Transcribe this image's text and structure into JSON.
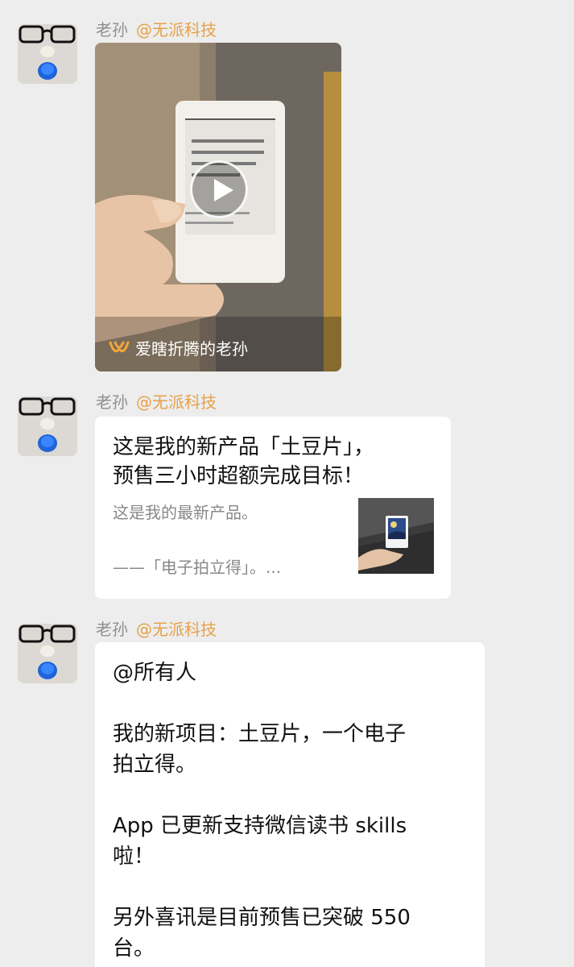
{
  "messages": [
    {
      "sender": "老孙",
      "group_tag": "@无派科技",
      "type": "video",
      "video": {
        "caption": "爱瞎折腾的老孙",
        "caption_icon": "wechat-channels-icon"
      }
    },
    {
      "sender": "老孙",
      "group_tag": "@无派科技",
      "type": "link-card",
      "card": {
        "title_line1": "这是我的新产品「土豆片」，",
        "title_line2": "预售三小时超额完成目标！",
        "desc_line1": "这是我的最新产品。",
        "desc_line2": "——「电子拍立得」。..."
      }
    },
    {
      "sender": "老孙",
      "group_tag": "@无派科技",
      "type": "text",
      "text_lines": [
        "@所有人",
        "",
        "我的新项目：土豆片，一个电子",
        "拍立得。",
        "",
        "App 已更新支持微信读书 skills",
        "啦！",
        "",
        "另外喜讯是目前预售已突破 550",
        "台。"
      ]
    }
  ],
  "colors": {
    "background": "#ededed",
    "bubble": "#ffffff",
    "sender_name": "#8f8f8f",
    "group_tag": "#e6a14a"
  }
}
